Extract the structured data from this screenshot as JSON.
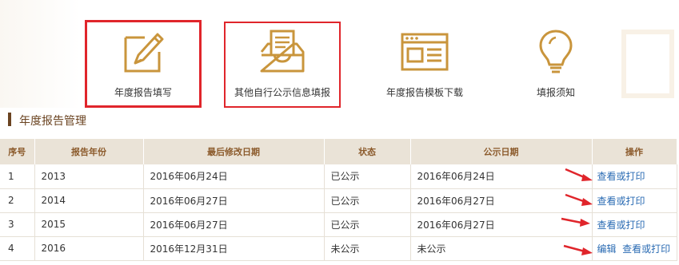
{
  "tiles": [
    {
      "label": "年度报告填写",
      "icon": "edit-icon"
    },
    {
      "label": "其他自行公示信息填报",
      "icon": "inbox-icon"
    },
    {
      "label": "年度报告模板下载",
      "icon": "template-icon"
    },
    {
      "label": "填报须知",
      "icon": "lightbulb-icon"
    }
  ],
  "section_title": "年度报告管理",
  "table": {
    "headers": [
      "序号",
      "报告年份",
      "最后修改日期",
      "状态",
      "公示日期",
      "操作"
    ],
    "rows": [
      {
        "idx": "1",
        "year": "2013",
        "modified": "2016年06月24日",
        "status": "已公示",
        "public_date": "2016年06月24日",
        "edit": "",
        "view": "查看或打印"
      },
      {
        "idx": "2",
        "year": "2014",
        "modified": "2016年06月27日",
        "status": "已公示",
        "public_date": "2016年06月27日",
        "edit": "",
        "view": "查看或打印"
      },
      {
        "idx": "3",
        "year": "2015",
        "modified": "2016年06月27日",
        "status": "已公示",
        "public_date": "2016年06月27日",
        "edit": "",
        "view": "查看或打印"
      },
      {
        "idx": "4",
        "year": "2016",
        "modified": "2016年12月31日",
        "status": "未公示",
        "public_date": "未公示",
        "edit": "编辑",
        "view": "查看或打印"
      }
    ]
  },
  "colors": {
    "brand": "#6b4422",
    "icon": "#c9953c",
    "highlight": "#e0252b",
    "link": "#2a6bb3",
    "arrow": "#e0252b"
  }
}
